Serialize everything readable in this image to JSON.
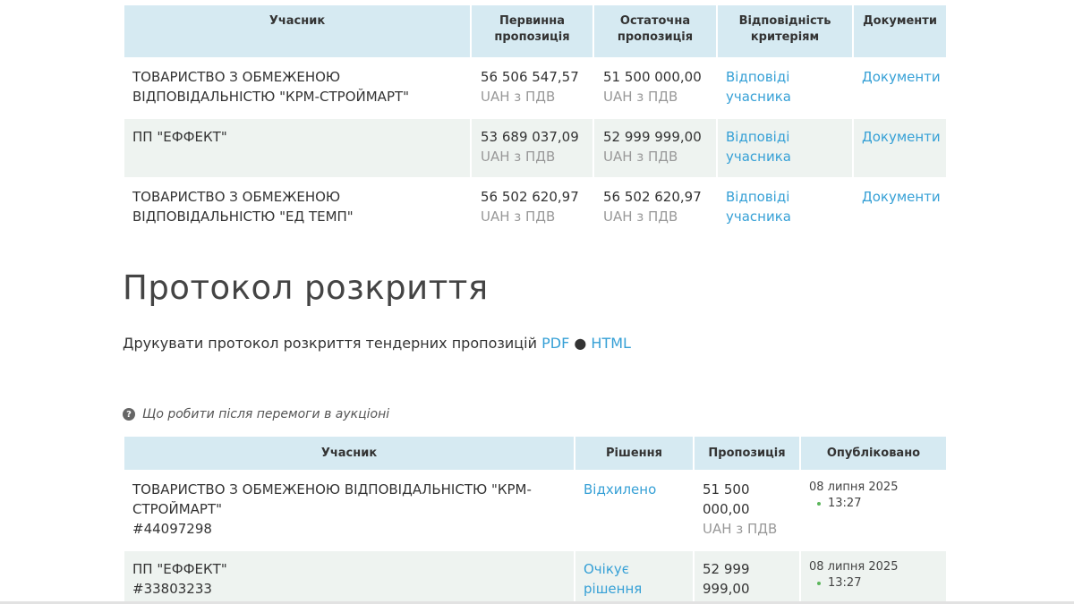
{
  "bids_table": {
    "headers": [
      "Учасник",
      "Первинна пропозиція",
      "Остаточна пропозиція",
      "Відповідність критеріям",
      "Документи"
    ],
    "rows": [
      {
        "participant": "ТОВАРИСТВО З ОБМЕЖЕНОЮ ВІДПОВІДАЛЬНІСТЮ \"КРМ-СТРОЙМАРТ\"",
        "initial_value": "56 506 547,57",
        "initial_unit": "UAH з ПДВ",
        "final_value": "51 500 000,00",
        "final_unit": "UAH з ПДВ",
        "criteria_link": "Відповіді учасника",
        "documents_link": "Документи"
      },
      {
        "participant": "ПП \"ЕФФЕКТ\"",
        "initial_value": "53 689 037,09",
        "initial_unit": "UAH з ПДВ",
        "final_value": "52 999 999,00",
        "final_unit": "UAH з ПДВ",
        "criteria_link": "Відповіді учасника",
        "documents_link": "Документи"
      },
      {
        "participant": "ТОВАРИСТВО З ОБМЕЖЕНОЮ ВІДПОВІДАЛЬНІСТЮ \"ЕД ТЕМП\"",
        "initial_value": "56 502 620,97",
        "initial_unit": "UAH з ПДВ",
        "final_value": "56 502 620,97",
        "final_unit": "UAH з ПДВ",
        "criteria_link": "Відповіді учасника",
        "documents_link": "Документи"
      }
    ]
  },
  "protocol": {
    "title": "Протокол розкриття",
    "print_text": "Друкувати протокол розкриття тендерних пропозицій",
    "pdf_link": "PDF",
    "separator": "●",
    "html_link": "HTML"
  },
  "help": {
    "icon": "question-circle-icon",
    "text": "Що робити після перемоги в аукціоні"
  },
  "decisions_table": {
    "headers": [
      "Учасник",
      "Рішення",
      "Пропозиція",
      "Опубліковано"
    ],
    "rows": [
      {
        "participant": "ТОВАРИСТВО З ОБМЕЖЕНОЮ ВІДПОВІДАЛЬНІСТЮ \"КРМ-СТРОЙМАРТ\"",
        "code": "#44097298",
        "decision": "Відхилено",
        "offer_value": "51 500 000,00",
        "offer_unit": "UAH з ПДВ",
        "date": "08 липня 2025",
        "time": "13:27"
      },
      {
        "participant": "ПП \"ЕФФЕКТ\"",
        "code": "#33803233",
        "decision": "Очікує рішення",
        "offer_value": "52 999 999,00",
        "offer_unit": "",
        "date": "08 липня 2025",
        "time": "13:27"
      }
    ]
  },
  "colors": {
    "header_bg": "#d6eaf2",
    "row_shade": "#eef3f0",
    "link": "#36a0d6",
    "muted": "#999999",
    "time_dot": "#5bb55b"
  }
}
